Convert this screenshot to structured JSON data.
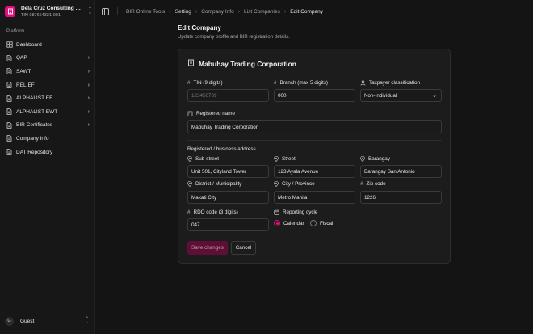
{
  "colors": {
    "accent": "#e0117f",
    "background": "#141414",
    "sidebar": "#171717",
    "card": "#1c1c1c"
  },
  "org": {
    "name": "Dela Cruz Consulting Services",
    "tin": "TIN 987654321-001",
    "logo_icon": "building-icon"
  },
  "sidebar": {
    "section_label": "Platform",
    "items": [
      {
        "label": "Dashboard",
        "icon": "dashboard-icon",
        "has_chevron": false
      },
      {
        "label": "QAP",
        "icon": "document-icon",
        "has_chevron": true
      },
      {
        "label": "SAWT",
        "icon": "document-icon",
        "has_chevron": true
      },
      {
        "label": "RELIEF",
        "icon": "document-icon",
        "has_chevron": true
      },
      {
        "label": "ALPHALIST EE",
        "icon": "document-icon",
        "has_chevron": true
      },
      {
        "label": "ALPHALIST EWT",
        "icon": "document-icon",
        "has_chevron": true
      },
      {
        "label": "BIR Certificates",
        "icon": "document-icon",
        "has_chevron": true
      },
      {
        "label": "Company Info",
        "icon": "document-icon",
        "has_chevron": false
      },
      {
        "label": "DAT Repository",
        "icon": "document-icon",
        "has_chevron": false
      }
    ],
    "user": {
      "initial": "G",
      "label": "Guest"
    }
  },
  "breadcrumb": [
    "BIR Online Tools",
    "Setting",
    "Company Info",
    "List Companies",
    "Edit Company"
  ],
  "page": {
    "title": "Edit Company",
    "subtitle": "Update company profile and BIR registration details."
  },
  "form": {
    "company_name": "Mabuhay Trading Corporation",
    "tin": {
      "label": "TIN (9 digits)",
      "value": "",
      "placeholder": "123456789"
    },
    "branch": {
      "label": "Branch (max 5 digits)",
      "value": "000"
    },
    "taxpayer_classification": {
      "label": "Taxpayer classification",
      "value": "Non-Individual"
    },
    "registered_name": {
      "label": "Registered name",
      "value": "Mabuhay Trading Corporation"
    },
    "address_section_label": "Registered / business address",
    "sub_street": {
      "label": "Sub-street",
      "value": "Unit 501, Cityland Tower"
    },
    "street": {
      "label": "Street",
      "value": "123 Ayala Avenue"
    },
    "barangay": {
      "label": "Barangay",
      "value": "Barangay San Antonio"
    },
    "district": {
      "label": "District / Municipality",
      "value": "Makati City"
    },
    "city": {
      "label": "City / Province",
      "value": "Metro Manila"
    },
    "zip": {
      "label": "Zip code",
      "value": "1226"
    },
    "rdo": {
      "label": "RDO code (3 digits)",
      "value": "047"
    },
    "reporting_cycle": {
      "label": "Reporting cycle",
      "options": [
        "Calendar",
        "Fiscal"
      ],
      "selected": "Calendar"
    },
    "save_label": "Save changes",
    "cancel_label": "Cancel"
  }
}
